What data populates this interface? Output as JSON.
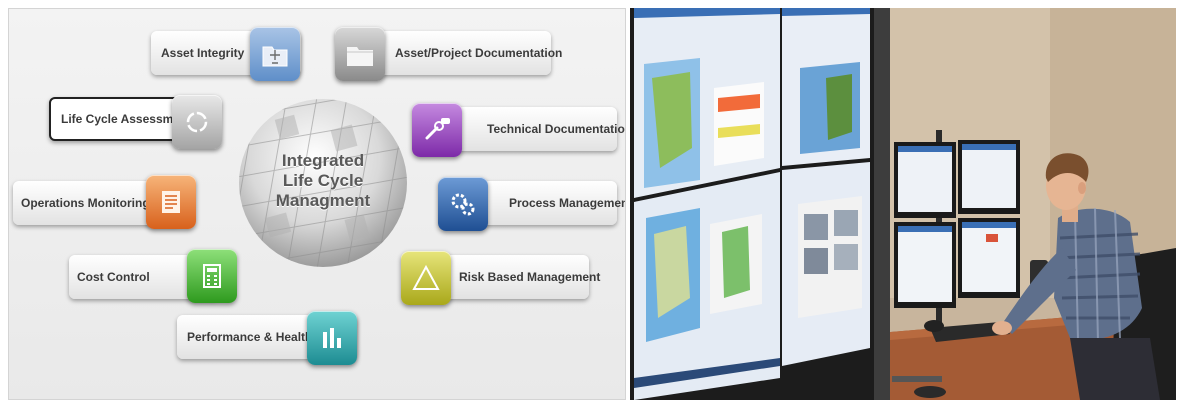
{
  "diagram": {
    "center_title_lines": [
      "Integrated",
      "Life Cycle",
      "Managment"
    ],
    "items": [
      {
        "label": "Asset Integrity",
        "icon": "folder-document-icon",
        "color": "#5f8fc9"
      },
      {
        "label": "Asset/Project Documentation",
        "icon": "folder-icon",
        "color": "#8a8a8a"
      },
      {
        "label": "Life Cycle Assessment",
        "icon": "cycle-arrows-icon",
        "color": "#a4a4a4"
      },
      {
        "label": "Technical Documentation",
        "icon": "wrench-chat-icon",
        "color": "#7d2aa8"
      },
      {
        "label": "Operations Monitoring",
        "icon": "document-list-icon",
        "color": "#d8611c"
      },
      {
        "label": "Process Management",
        "icon": "gears-icon",
        "color": "#1f4f93"
      },
      {
        "label": "Cost Control",
        "icon": "calculator-icon",
        "color": "#2e9a1e"
      },
      {
        "label": "Risk Based Management",
        "icon": "warning-triangle-icon",
        "color": "#a9a81a"
      },
      {
        "label": "Performance & Health",
        "icon": "bar-chart-icon",
        "color": "#1d8c92"
      }
    ]
  },
  "photo": {
    "subject": "control-room-operator-photo"
  }
}
